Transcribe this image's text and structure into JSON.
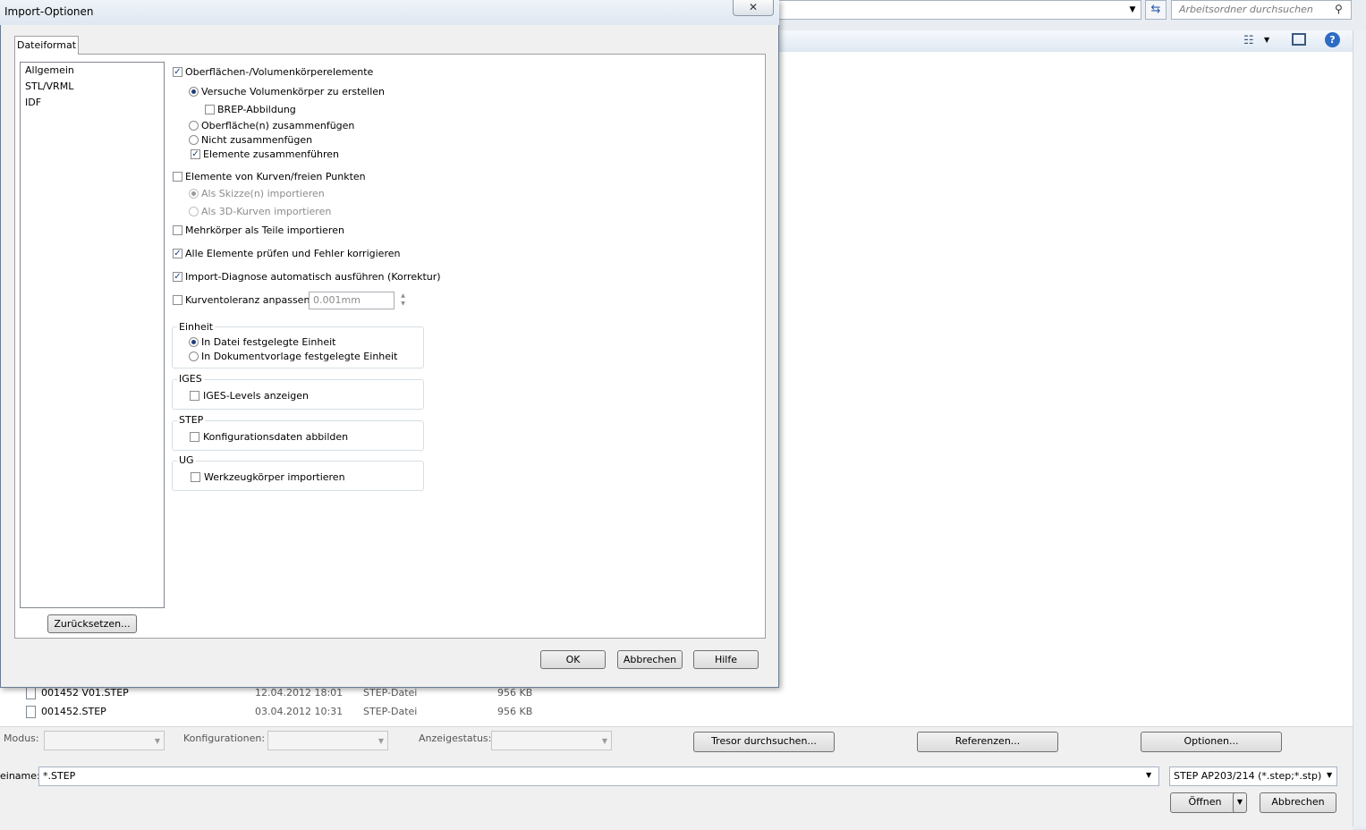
{
  "dialog": {
    "title": "Import-Optionen",
    "close_label": "✕",
    "tab": "Dateiformat",
    "categories": [
      "Allgemein",
      "STL/VRML",
      "IDF"
    ],
    "reset_label": "Zurücksetzen...",
    "ok_label": "OK",
    "cancel_label": "Abbrechen",
    "help_label": "Hilfe",
    "options": {
      "surfaces": "Oberflächen-/Volumenkörperelemente",
      "try_solids": "Versuche Volumenkörper zu erstellen",
      "brep": "BREP-Abbildung",
      "knit_surfaces": "Oberfläche(n) zusammenfügen",
      "no_knit": "Nicht zusammenfügen",
      "merge_entities": "Elemente zusammenführen",
      "curves": "Elemente von Kurven/freien Punkten",
      "as_sketch": "Als Skizze(n) importieren",
      "as_3d_curves": "Als 3D-Kurven importieren",
      "multibody": "Mehrkörper als Teile importieren",
      "check_entities": "Alle Elemente prüfen und Fehler korrigieren",
      "import_diag": "Import-Diagnose automatisch ausführen (Korrektur)",
      "curve_tol": "Kurventoleranz anpassen:",
      "curve_tol_value": "0.001mm"
    },
    "unit_group": {
      "title": "Einheit",
      "from_file": "In Datei festgelegte Einheit",
      "from_template": "In Dokumentvorlage festgelegte Einheit"
    },
    "iges_group": {
      "title": "IGES",
      "show_levels": "IGES-Levels anzeigen"
    },
    "step_group": {
      "title": "STEP",
      "config_data": "Konfigurationsdaten abbilden"
    },
    "ug_group": {
      "title": "UG",
      "tool_bodies": "Werkzeugkörper importieren"
    }
  },
  "open_dialog": {
    "search_placeholder": "Arbeitsordner durchsuchen",
    "files": [
      {
        "name": "001452 V01.STEP",
        "date": "12.04.2012 18:01",
        "type": "STEP-Datei",
        "size": "956 KB"
      },
      {
        "name": "001452.STEP",
        "date": "03.04.2012 10:31",
        "type": "STEP-Datei",
        "size": "956 KB"
      }
    ],
    "modus_label": "Modus:",
    "configs_label": "Konfigurationen:",
    "display_state_label": "Anzeigestatus:",
    "vault_button": "Tresor durchsuchen...",
    "references_button": "Referenzen...",
    "options_button": "Optionen...",
    "filename_label": "einame:",
    "filename_value": "*.STEP",
    "filetype_value": "STEP AP203/214 (*.step;*.stp)",
    "open_button": "Öffnen",
    "cancel_button": "Abbrechen"
  },
  "icons": [
    "search-icon",
    "refresh-icon",
    "view-icon",
    "preview-pane-icon",
    "help-icon",
    "file-icon",
    "close-icon",
    "chevron-down-icon"
  ]
}
